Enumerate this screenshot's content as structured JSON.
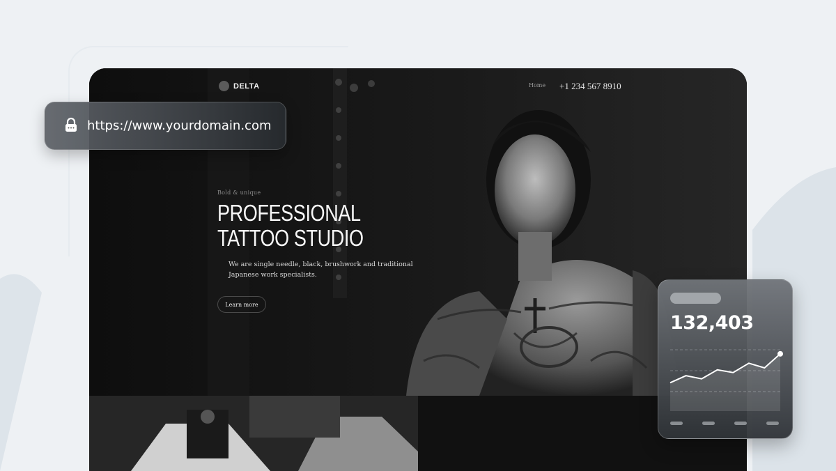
{
  "url_bar": {
    "url": "https://www.yourdomain.com"
  },
  "site": {
    "logo": "DELTA",
    "nav": {
      "home": "Home",
      "phone": "+1 234 567 8910"
    },
    "hero": {
      "kicker": "Bold & unique",
      "title": "PROFESSIONAL TATTOO STUDIO",
      "description": "We are single needle, black, brushwork and traditional Japanese work specialists.",
      "cta": "Learn more"
    }
  },
  "stat_card": {
    "value": "132,403",
    "trend": [
      0.12,
      0.3,
      0.22,
      0.45,
      0.38,
      0.62,
      0.5,
      0.86
    ]
  },
  "colors": {
    "page_bg": "#eef1f4",
    "site_bg": "#141414",
    "accent": "#ffffff"
  }
}
